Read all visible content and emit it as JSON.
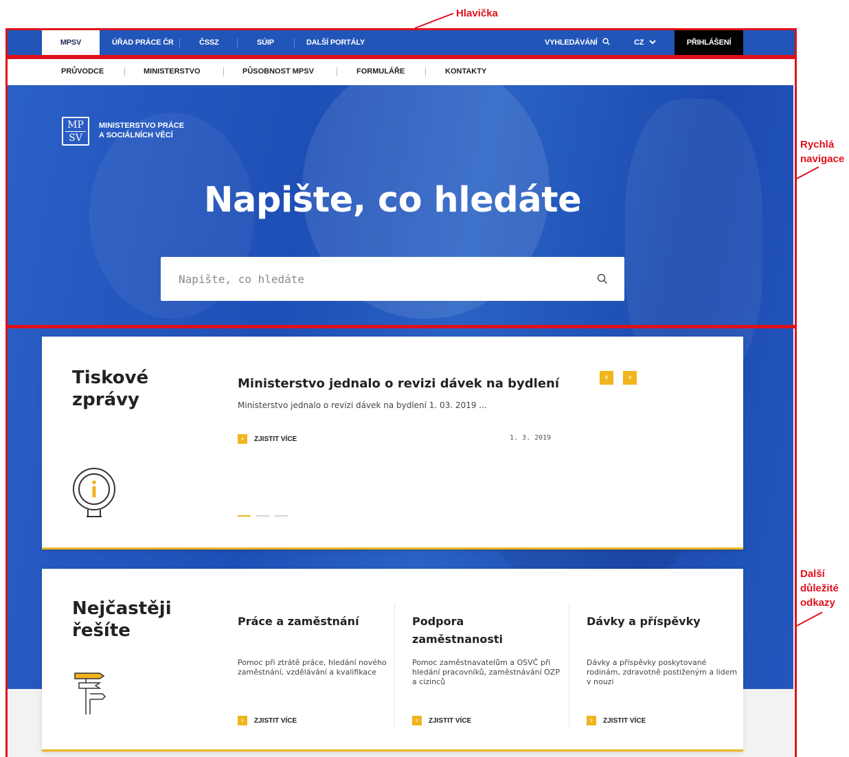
{
  "annotations": {
    "header": "Hlavička",
    "quick_nav_line1": "Rychlá",
    "quick_nav_line2": "navigace",
    "links_line1": "Další",
    "links_line2": "důležité",
    "links_line3": "odkazy"
  },
  "topbar": {
    "items": [
      "MPSV",
      "ÚŘAD PRÁCE ČR",
      "ČSSZ",
      "SÚIP",
      "DALŠÍ PORTÁLY"
    ],
    "search_label": "VYHLEDÁVÁNÍ",
    "language": "CZ",
    "login": "PŘIHLÁŠENÍ"
  },
  "subnav": {
    "items": [
      "PRŮVODCE",
      "MINISTERSTVO",
      "PŮSOBNOST MPSV",
      "FORMULÁŘE",
      "KONTAKTY"
    ]
  },
  "brand": {
    "logo_top": "MP",
    "logo_bottom": "SV",
    "name_line1": "MINISTERSTVO PRÁCE",
    "name_line2": "A SOCIÁLNÍCH VĚCÍ"
  },
  "hero": {
    "title": "Napište, co hledáte",
    "search_placeholder": "Napište, co hledáte"
  },
  "news": {
    "title_line1": "Tiskové",
    "title_line2": "zprávy",
    "headline": "Ministerstvo jednalo o revizi dávek na bydlení",
    "excerpt": "Ministerstvo jednalo o revizi dávek na bydlení 1. 03. 2019 ...",
    "more": "ZJISTIT VÍCE",
    "date": "1. 3. 2019"
  },
  "frequent": {
    "title_line1": "Nejčastěji",
    "title_line2": "řešíte",
    "columns": [
      {
        "title": "Práce a zaměstnání",
        "text": "Pomoc při ztrátě práce, hledání nového zaměstnání, vzdělávání a kvalifikace",
        "more": "ZJISTIT VÍCE"
      },
      {
        "title": "Podpora zaměstnanosti",
        "text": "Pomoc zaměstnavatelům a OSVČ při hledání pracovníků, zaměstnávání OZP a cizinců",
        "more": "ZJISTIT VÍCE"
      },
      {
        "title": "Dávky a příspěvky",
        "text": "Dávky a příspěvky poskytované rodinám, zdravotně postiženým a lidem v nouzi",
        "more": "ZJISTIT VÍCE"
      }
    ]
  },
  "colors": {
    "brand_blue": "#2155b8",
    "accent_yellow": "#f0b41c",
    "annotation_red": "#e0101b"
  }
}
